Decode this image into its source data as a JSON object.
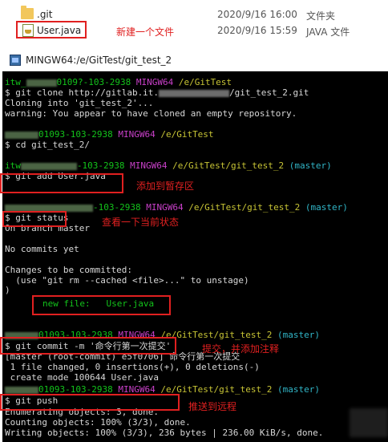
{
  "explorer": {
    "rows": [
      {
        "name": ".git",
        "date": "2020/9/16 16:00",
        "type": "文件夹",
        "icon": "folder-icon"
      },
      {
        "name": "User.java",
        "date": "2020/9/16 15:59",
        "type": "JAVA 文件",
        "icon": "java-file-icon"
      }
    ],
    "annotation": "新建一个文件"
  },
  "terminal": {
    "title": "MINGW64:/e/GitTest/git_test_2",
    "blocks": {
      "p1_user": "itw_",
      "p1_host": "0109?-103-2938",
      "p1_shell": "MINGW64",
      "p1_path": "/e/GitTest",
      "cmd1": "$ git clone http://gitlab.it.",
      "cmd1_tail": "/git_test_2.git",
      "out1a": "Cloning into 'git_test_2'...",
      "out1b": "warning: You appear to have cloned an empty repository.",
      "p2_host": "01093-103-2938",
      "p2_shell": "MINGW64",
      "p2_path": "/e/GitTest",
      "cmd2": "$ cd git_test_2/",
      "p3_user": "itw",
      "p3_host": "-103-2938",
      "p3_shell": "MINGW64",
      "p3_path": "/e/GitTest/git_test_2",
      "p3_branch": "(master)",
      "cmd3": "$ git add User.java",
      "p4_host": "-103-2938",
      "p4_shell": "MINGW64",
      "p4_path": "/e/GitTest/git_test_2",
      "p4_branch": "(master)",
      "cmd4": "$ git status",
      "out4a": "On branch master",
      "out4b": "No commits yet",
      "out4c": "Changes to be committed:",
      "out4d": "  (use \"git rm --cached <file>...\" to unstage)",
      "out4e": ")",
      "out4f_label": "new file:",
      "out4f_file": "User.java",
      "p5_host": "01093-103-2938",
      "p5_shell": "MINGW64",
      "p5_path": "/e/GitTest/git_test_2",
      "p5_branch": "(master)",
      "cmd5": "$ git commit -m '命令行第一次提交'",
      "out5a": "[master (root-commit) e5f0706] 命令行第一次提交",
      "out5b": " 1 file changed, 0 insertions(+), 0 deletions(-)",
      "out5c": " create mode 100644 User.java",
      "p6_host": "01093-103-2938",
      "p6_shell": "MINGW64",
      "p6_path": "/e/GitTest/git_test_2",
      "p6_branch": "(master)",
      "cmd6": "$ git push",
      "out6a": "Enumerating objects: 3, done.",
      "out6b": "Counting objects: 100% (3/3), done.",
      "out6c": "Writing objects: 100% (3/3), 236 bytes | 236.00 KiB/s, done."
    }
  },
  "annotations": {
    "add": "添加到暂存区",
    "status": "查看一下当前状态",
    "commit": "提交，并添加注释",
    "push": "推送到远程"
  },
  "colors": {
    "annotation_red": "#e02020",
    "term_green": "#13c31b",
    "term_magenta": "#c940c9",
    "term_yellow": "#c7c435",
    "term_cyan": "#31b6c8"
  }
}
